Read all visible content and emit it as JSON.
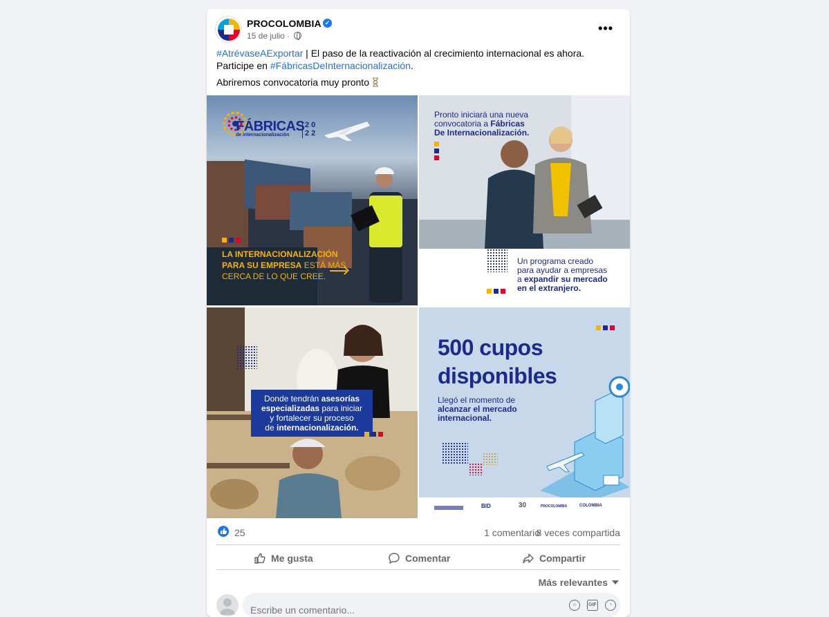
{
  "post": {
    "page_name": "PROCOLOMBIA",
    "date": "15 de julio",
    "text_hashtag1": "#AtrévaseAExportar",
    "text_middle": " | El paso de la reactivación al crecimiento internacional es ahora. Participe en ",
    "text_hashtag2": "#FábricasDeInternacionalización",
    "text_end": ".",
    "text_line2": "Abriremos convocatoria muy pronto",
    "more_label": "•••"
  },
  "images": {
    "tile1": {
      "logo_title": "FÁBRICAS",
      "logo_sub": "de internacionalización",
      "logo_year1": "2 0",
      "logo_year2": "2 2",
      "line1": "LA INTERNACIONALIZACIÓN",
      "line2a": "PARA SU EMPRESA",
      "line2b": " ESTÁ MÁS",
      "line3": "CERCA DE LO QUE CREE."
    },
    "tile2": {
      "top1": "Pronto iniciará una nueva",
      "top2": "convocatoria a ",
      "top2b": "Fábricas",
      "top3": "De Internacionalización.",
      "bot1": "Un programa creado",
      "bot2": "para ayudar a empresas",
      "bot3a": "a ",
      "bot3b": "expandir su mercado",
      "bot4": "en el extranjero."
    },
    "tile3": {
      "l1a": "Donde tendrán ",
      "l1b": "asesorías",
      "l2a": "especializadas",
      "l2b": " para iniciar",
      "l3": "y fortalecer su proceso",
      "l4a": "de ",
      "l4b": "internacionalización."
    },
    "tile4": {
      "big1": "500 cupos",
      "big2": "disponibles",
      "s1": "Llegó el momento de",
      "s2": "alcanzar el mercado",
      "s3": "internacional.",
      "logo_bid": "BID",
      "logo_30": "30",
      "logo_pc": "PROCOLOMBIA",
      "logo_col": "COLOMBIA"
    }
  },
  "engagement": {
    "likes": "25",
    "comments": "1 comentario",
    "shares": "8 veces compartida"
  },
  "actions": {
    "like": "Me gusta",
    "comment": "Comentar",
    "share": "Compartir"
  },
  "sort_label": "Más relevantes",
  "comment_box": {
    "placeholder": "Escribe un comentario...",
    "gif_label": "GIF"
  },
  "colors": {
    "accent": "#1877f2",
    "brand_blue": "#1b2a8c",
    "brand_yellow": "#f6b400",
    "brand_red": "#e4002b"
  }
}
